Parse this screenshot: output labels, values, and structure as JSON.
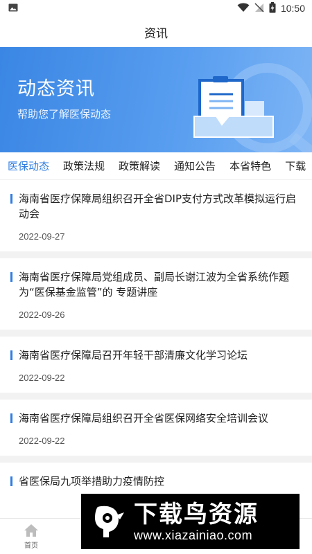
{
  "status": {
    "time": "10:50"
  },
  "header": {
    "title": "资讯"
  },
  "banner": {
    "title": "动态资讯",
    "subtitle": "帮助您了解医保动态"
  },
  "tabs": [
    {
      "label": "医保动态",
      "active": true
    },
    {
      "label": "政策法规"
    },
    {
      "label": "政策解读"
    },
    {
      "label": "通知公告"
    },
    {
      "label": "本省特色"
    },
    {
      "label": "下载"
    }
  ],
  "news": [
    {
      "title": "海南省医疗保障局组织召开全省DIP支付方式改革模拟运行启动会",
      "date": "2022-09-27"
    },
    {
      "title": "海南省医疗保障局党组成员、副局长谢江波为全省系统作题为“医保基金监管”的 专题讲座",
      "date": "2022-09-26"
    },
    {
      "title": "海南省医疗保障局召开年轻干部清廉文化学习论坛",
      "date": "2022-09-22"
    },
    {
      "title": "海南省医疗保障局组织召开全省医保网络安全培训会议",
      "date": "2022-09-22"
    },
    {
      "title": "省医保局九项举措助力疫情防控"
    }
  ],
  "bottom_nav": {
    "home_label": "首页"
  },
  "watermark": {
    "brand": "下载鸟资源",
    "url": "www.xiazainiao.com"
  },
  "colors": {
    "accent": "#2f7de1",
    "banner": "#4a92ea"
  }
}
